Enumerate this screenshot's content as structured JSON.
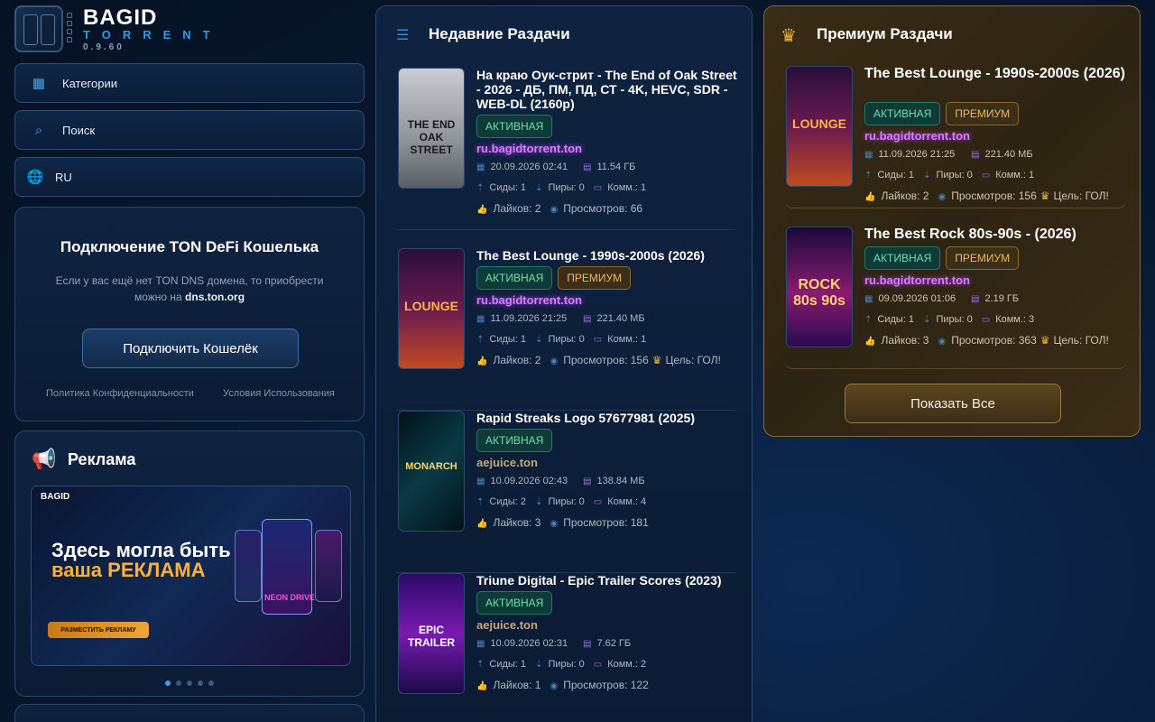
{
  "brand": {
    "title": "BAGID",
    "subtitle": "TORRENT",
    "version": "0.9.60"
  },
  "nav": [
    {
      "icon": "grid-icon",
      "label": "Категории"
    },
    {
      "icon": "search-icon",
      "label": "Поиск"
    },
    {
      "icon": "globe-icon",
      "label": "RU"
    }
  ],
  "wallet": {
    "title": "Подключение TON DeFi Кошелька",
    "desc": "Если у вас ещё нет TON DNS домена, то приобрести можно на",
    "link": "dns.ton.org",
    "button": "Подключить Кошелёк",
    "privacy": "Политика Конфиденциальности",
    "terms": "Условия Использования"
  },
  "ads": {
    "title": "Реклама",
    "banner_line1": "Здесь могла быть",
    "banner_line2": "ваша РЕКЛАМА",
    "banner_button": "РАЗМЕСТИТЬ РЕКЛАМУ",
    "banner_logo": "BAGID",
    "banner_card": "NEON DRIVE",
    "slides": 5,
    "active_slide": 0
  },
  "recent": {
    "title": "Недавние Раздачи",
    "items": [
      {
        "title": "На краю Оук-стрит - The End of Oak Street - 2026 - ДБ, ПМ, ПД, СТ - 4K, HEVC, SDR - WEB-DL (2160p)",
        "status": "АКТИВНАЯ",
        "premium": null,
        "domain": "ru.bagidtorrent.ton",
        "date": "20.09.2026 02:41",
        "size": "11.54 ГБ",
        "seeds": "Сиды: 1",
        "peers": "Пиры: 0",
        "comments": "Комм.: 1",
        "likes": "Лайков: 2",
        "views": "Просмотров: 66",
        "goal": null,
        "poster": "THE END OAK STREET"
      },
      {
        "title": "The Best Lounge - 1990s-2000s (2026)",
        "status": "АКТИВНАЯ",
        "premium": "ПРЕМИУМ",
        "domain": "ru.bagidtorrent.ton",
        "date": "11.09.2026 21:25",
        "size": "221.40 МБ",
        "seeds": "Сиды: 1",
        "peers": "Пиры: 0",
        "comments": "Комм.: 1",
        "likes": "Лайков: 2",
        "views": "Просмотров: 156",
        "goal": "Цель: ГОЛ!",
        "poster": "LOUNGE"
      },
      {
        "title": "Rapid Streaks Logo 57677981 (2025)",
        "status": "АКТИВНАЯ",
        "premium": null,
        "domain": "aejuice.ton",
        "date": "10.09.2026 02:43",
        "size": "138.84 МБ",
        "seeds": "Сиды: 2",
        "peers": "Пиры: 0",
        "comments": "Комм.: 4",
        "likes": "Лайков: 3",
        "views": "Просмотров: 181",
        "goal": null,
        "poster": "MONARCH"
      },
      {
        "title": "Triune Digital - Epic Trailer Scores (2023)",
        "status": "АКТИВНАЯ",
        "premium": null,
        "domain": "aejuice.ton",
        "date": "10.09.2026 02:31",
        "size": "7.62 ГБ",
        "seeds": "Сиды: 1",
        "peers": "Пиры: 0",
        "comments": "Комм.: 2",
        "likes": "Лайков: 1",
        "views": "Просмотров: 122",
        "goal": null,
        "poster": "EPIC TRAILER"
      }
    ]
  },
  "premium": {
    "title": "Премиум Раздачи",
    "button": "Показать Все",
    "items": [
      {
        "title": "The Best Lounge - 1990s-2000s (2026)",
        "status": "АКТИВНАЯ",
        "premium": "ПРЕМИУМ",
        "domain": "ru.bagidtorrent.ton",
        "date": "11.09.2026 21:25",
        "size": "221.40 МБ",
        "seeds": "Сиды: 1",
        "peers": "Пиры: 0",
        "comments": "Комм.: 1",
        "likes": "Лайков: 2",
        "views": "Просмотров: 156",
        "goal": "Цель: ГОЛ!",
        "poster": "LOUNGE"
      },
      {
        "title": "The Best Rock 80s-90s - (2026)",
        "status": "АКТИВНАЯ",
        "premium": "ПРЕМИУМ",
        "domain": "ru.bagidtorrent.ton",
        "date": "09.09.2026 01:06",
        "size": "2.19 ГБ",
        "seeds": "Сиды: 1",
        "peers": "Пиры: 0",
        "comments": "Комм.: 3",
        "likes": "Лайков: 3",
        "views": "Просмотров: 363",
        "goal": "Цель: ГОЛ!",
        "poster": "ROCK 80s 90s"
      }
    ]
  }
}
